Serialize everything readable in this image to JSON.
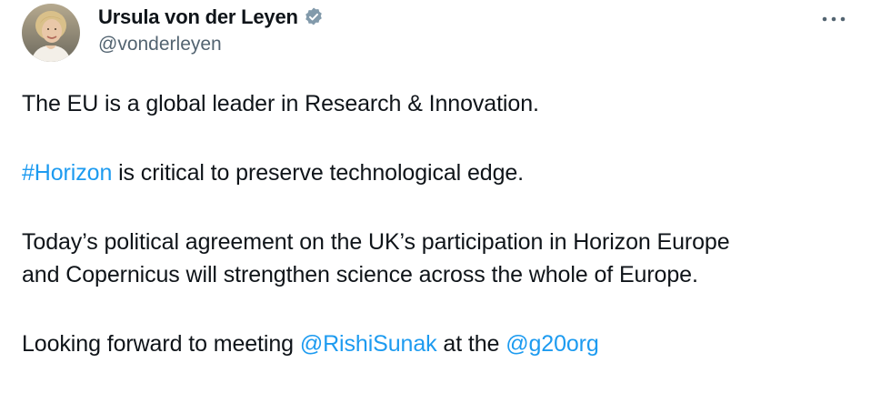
{
  "author": {
    "display_name": "Ursula von der Leyen",
    "handle": "@vonderleyen",
    "verified_color": "#829aab"
  },
  "menu": {
    "icon": "more-horizontal-icon"
  },
  "tweet": {
    "line1": "The EU is a global leader in Research & Innovation.",
    "hashtag": "#Horizon",
    "line2_rest": " is critical to preserve technological edge.",
    "line3a": "Today’s political agreement on the UK’s participation in Horizon Europe",
    "line3b": "and Copernicus will strengthen science across the whole of Europe.",
    "line4_start": "Looking forward to meeting ",
    "mention1": "@RishiSunak",
    "line4_mid": " at the ",
    "mention2": "@g20org"
  },
  "colors": {
    "text": "#0f1419",
    "secondary": "#536471",
    "link": "#1d9bf0"
  }
}
